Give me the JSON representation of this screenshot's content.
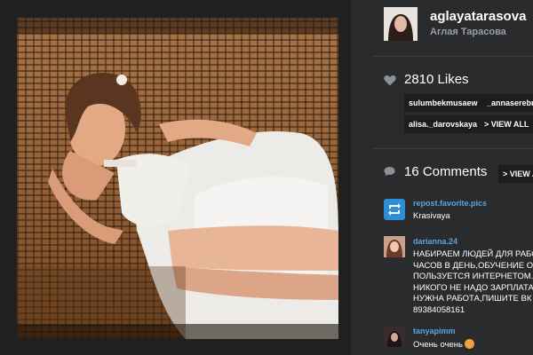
{
  "profile": {
    "username": "aglayatarasova",
    "full_name": "Аглая Тарасова"
  },
  "likes": {
    "label": "2810 Likes",
    "users": [
      "sulumbekmusaew",
      "_annaserebr",
      "alisa._darovskaya"
    ],
    "view_all": "> VIEW ALL"
  },
  "comments": {
    "label": "16 Comments",
    "view_all": "> VIEW A",
    "items": [
      {
        "user": "repost.favorite.pics",
        "lines": [
          "Krasivaya"
        ]
      },
      {
        "user": "darianna.24",
        "lines": [
          "НАБИРАЕМ ЛЮДЕЙ ДЛЯ РАБО",
          "ЧАСОВ В ДЕНЬ,ОБУЧЕНИЕ ОН",
          "ПОЛЬЗУЕТСЯ ИНТЕРНЕТОМ.Н",
          "НИКОГО НЕ НАДО ЗАРПЛАТА",
          "НУЖНА РАБОТА,ПИШИТЕ ВК Н",
          "89384058161"
        ]
      },
      {
        "user": "tanyapimm",
        "lines": [
          "Очень очень"
        ]
      }
    ]
  },
  "icons": {
    "likes": "heart-icon",
    "comments": "speech-bubble-icon",
    "repost": "repost-icon"
  },
  "colors": {
    "background": "#2a2b2d",
    "username_link": "#58a4e0",
    "tag_bg": "#1c1d1f"
  }
}
